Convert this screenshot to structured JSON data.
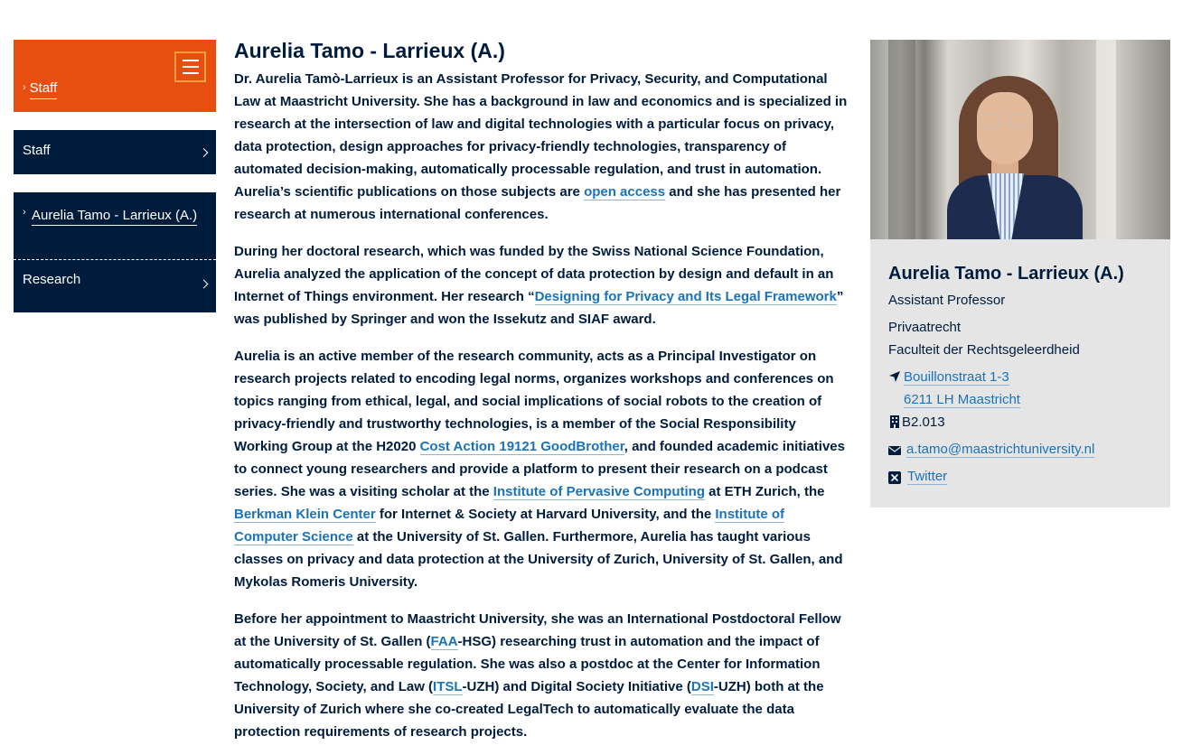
{
  "sidebar": {
    "breadcrumb_label": "Staff",
    "nav_staff_label": "Staff",
    "nav_person_label": "Aurelia Tamo - Larrieux (A.)",
    "nav_research_label": "Research"
  },
  "main": {
    "title": "Aurelia Tamo - Larrieux (A.)",
    "p1": {
      "t1": "Dr. Aurelia Tamò-Larrieux is an Assistant Professor for Privacy, Security, and Computational Law at Maastricht University. She has a background in law and economics and is specialized in research at the intersection of law and digital technologies with a particular focus on privacy, data protection, design approaches for privacy-friendly technologies, transparency of automated decision-making, automatically processable regulation, and trust in automation. Aurelia’s scientific publications on those subjects are ",
      "link1": "open access",
      "t2": " and she has presented her research at numerous international conferences."
    },
    "p2": {
      "t1": "During her doctoral research, which was funded by the Swiss National Science Foundation, Aurelia analyzed the application of the concept of data protection by design and default in an Internet of Things environment. Her research  “",
      "link1": "Designing for Privacy and Its Legal Framework",
      "t2": "” was published by Springer and won the Issekutz and SIAF award."
    },
    "p3": {
      "t1": "Aurelia is an active member of the research community, acts as a Principal Investigator on research projects related to encoding legal norms, organizes workshops and conferences on topics ranging from ethical, legal, and social implications of social robots to the creation of privacy-friendly and trustworthy technologies, is a member of the Social Responsibility Working Group at the H2020 ",
      "link1": "Cost Action 19121 GoodBrother",
      "t2": ", and founded academic initiatives to connect young researchers and provide a platform to present their research on a podcast series. She was a visiting scholar at the ",
      "link2": "Institute of Pervasive Computing",
      "t3": " at ETH Zurich, the ",
      "link3": "Berkman Klein Center",
      "t4": " for Internet & Society at Harvard University, and the ",
      "link4": "Institute of Computer Science",
      "t5": " at the University of St. Gallen. Furthermore, Aurelia has taught various classes on privacy and data protection at the University of Zurich, University of St. Gallen, and Mykolas Romeris University."
    },
    "p4": {
      "t1": "Before her appointment to Maastricht University, she was an International Postdoctoral Fellow at the University of St. Gallen (",
      "link1": "FAA",
      "t2": "-HSG) researching trust in automation and the impact of automatically processable regulation. She was also a postdoc at the Center for Information Technology, Society, and Law (",
      "link2": "ITSL",
      "t3": "-UZH) and Digital Society Initiative (",
      "link3": "DSI",
      "t4": "-UZH) both at the University of Zurich where she co-created LegalTech to automatically evaluate the data protection requirements of research projects."
    }
  },
  "card": {
    "name": "Aurelia Tamo - Larrieux (A.)",
    "position": "Assistant Professor",
    "department": "Privaatrecht",
    "faculty": "Faculteit der Rechtsgeleerdheid",
    "address_street": "Bouillonstraat 1-3",
    "address_city": "6211 LH Maastricht",
    "room": "B2.013",
    "email": "a.tamo@maastrichtuniversity.nl",
    "twitter": "Twitter"
  },
  "colors": {
    "brand_orange": "#e84e10",
    "navy": "#001c3d",
    "link_blue": "#1a73b9",
    "card_grey": "#e5e5e5"
  }
}
